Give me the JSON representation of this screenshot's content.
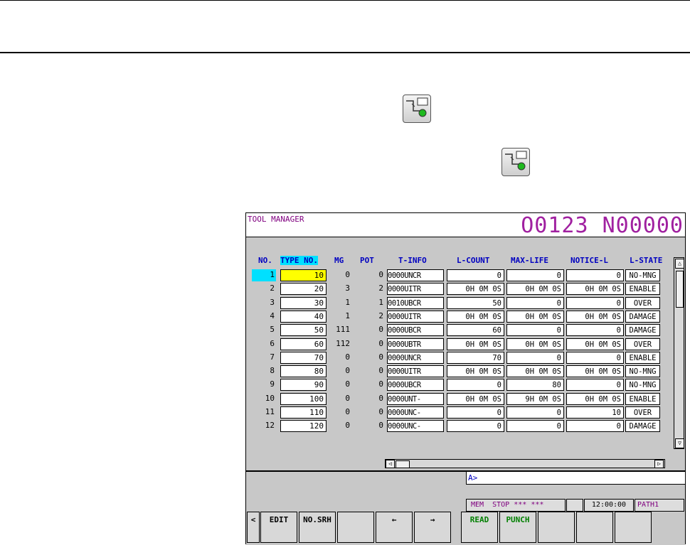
{
  "screen": {
    "title": "TOOL MANAGER",
    "program": "O0123 N00000",
    "columns": [
      "NO.",
      "TYPE NO.",
      "MG",
      "POT",
      "T-INFO",
      "L-COUNT",
      "MAX-LIFE",
      "NOTICE-L",
      "L-STATE"
    ],
    "rows": [
      {
        "no": "1",
        "type": "10",
        "mg": "0",
        "pot": "0",
        "tinfo": "0000UNCR",
        "lcount": "0",
        "maxlife": "0",
        "notice": "0",
        "lstate": "NO-MNG"
      },
      {
        "no": "2",
        "type": "20",
        "mg": "3",
        "pot": "2",
        "tinfo": "0000UITR",
        "lcount": "0H  0M  0S",
        "maxlife": "0H  0M  0S",
        "notice": "0H  0M  0S",
        "lstate": "ENABLE"
      },
      {
        "no": "3",
        "type": "30",
        "mg": "1",
        "pot": "1",
        "tinfo": "0010UBCR",
        "lcount": "50",
        "maxlife": "0",
        "notice": "0",
        "lstate": "OVER"
      },
      {
        "no": "4",
        "type": "40",
        "mg": "1",
        "pot": "2",
        "tinfo": "0000UITR",
        "lcount": "0H  0M  0S",
        "maxlife": "0H  0M  0S",
        "notice": "0H  0M  0S",
        "lstate": "DAMAGE"
      },
      {
        "no": "5",
        "type": "50",
        "mg": "111",
        "pot": "0",
        "tinfo": "0000UBCR",
        "lcount": "60",
        "maxlife": "0",
        "notice": "0",
        "lstate": "DAMAGE"
      },
      {
        "no": "6",
        "type": "60",
        "mg": "112",
        "pot": "0",
        "tinfo": "0000UBTR",
        "lcount": "0H  0M  0S",
        "maxlife": "0H  0M  0S",
        "notice": "0H  0M  0S",
        "lstate": "OVER"
      },
      {
        "no": "7",
        "type": "70",
        "mg": "0",
        "pot": "0",
        "tinfo": "0000UNCR",
        "lcount": "70",
        "maxlife": "0",
        "notice": "0",
        "lstate": "ENABLE"
      },
      {
        "no": "8",
        "type": "80",
        "mg": "0",
        "pot": "0",
        "tinfo": "0000UITR",
        "lcount": "0H  0M  0S",
        "maxlife": "0H  0M  0S",
        "notice": "0H  0M  0S",
        "lstate": "NO-MNG"
      },
      {
        "no": "9",
        "type": "90",
        "mg": "0",
        "pot": "0",
        "tinfo": "0000UBCR",
        "lcount": "0",
        "maxlife": "80",
        "notice": "0",
        "lstate": "NO-MNG"
      },
      {
        "no": "10",
        "type": "100",
        "mg": "0",
        "pot": "0",
        "tinfo": "0000UNT-",
        "lcount": "0H  0M  0S",
        "maxlife": "9H  0M  0S",
        "notice": "0H  0M  0S",
        "lstate": "ENABLE"
      },
      {
        "no": "11",
        "type": "110",
        "mg": "0",
        "pot": "0",
        "tinfo": "0000UNC-",
        "lcount": "0",
        "maxlife": "0",
        "notice": "10",
        "lstate": "OVER"
      },
      {
        "no": "12",
        "type": "120",
        "mg": "0",
        "pot": "0",
        "tinfo": "0000UNC-",
        "lcount": "0",
        "maxlife": "0",
        "notice": "0",
        "lstate": "DAMAGE"
      }
    ],
    "input_prompt": "A>",
    "status": {
      "mode": "MEM",
      "state": "STOP",
      "stars": "*** ***",
      "time": "12:00:00",
      "path": "PATH1"
    },
    "softkeys": [
      "<",
      "EDIT",
      "NO.SRH",
      "",
      "←",
      "→",
      "",
      "READ",
      "PUNCH",
      "",
      "",
      ""
    ]
  },
  "icons": [
    "offset-setting-key-icon",
    "offset-setting-key-icon"
  ],
  "colors": {
    "header_text": "#a020a0",
    "column_header": "#0000c0",
    "selected_no": "#00e0ff",
    "selected_cell": "#ffff00",
    "softkey_green": "#008000"
  }
}
